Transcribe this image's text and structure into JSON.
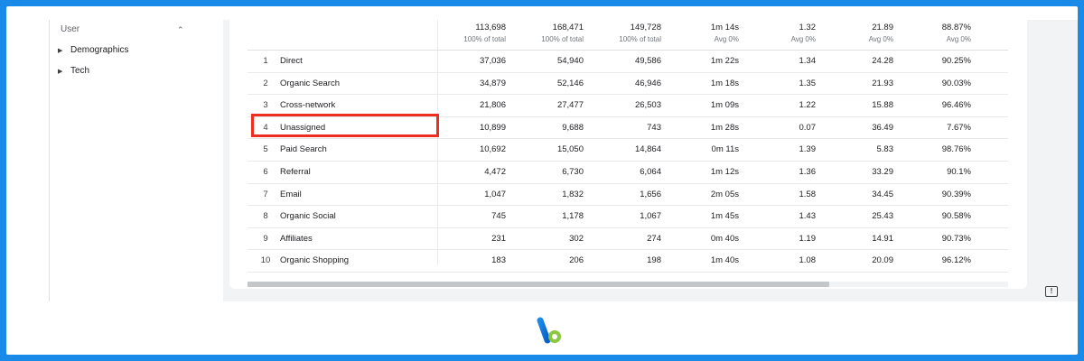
{
  "sidebar": {
    "section": "User",
    "items": [
      {
        "label": "Demographics"
      },
      {
        "label": "Tech"
      }
    ]
  },
  "table": {
    "totals": [
      {
        "value": "113,698",
        "sub": "100% of total"
      },
      {
        "value": "168,471",
        "sub": "100% of total"
      },
      {
        "value": "149,728",
        "sub": "100% of total"
      },
      {
        "value": "1m 14s",
        "sub": "Avg 0%"
      },
      {
        "value": "1.32",
        "sub": "Avg 0%"
      },
      {
        "value": "21.89",
        "sub": "Avg 0%"
      },
      {
        "value": "88.87%",
        "sub": "Avg 0%"
      }
    ],
    "rows": [
      {
        "idx": "1",
        "name": "Direct",
        "v": [
          "37,036",
          "54,940",
          "49,586",
          "1m 22s",
          "1.34",
          "24.28",
          "90.25%"
        ]
      },
      {
        "idx": "2",
        "name": "Organic Search",
        "v": [
          "34,879",
          "52,146",
          "46,946",
          "1m 18s",
          "1.35",
          "21.93",
          "90.03%"
        ]
      },
      {
        "idx": "3",
        "name": "Cross-network",
        "v": [
          "21,806",
          "27,477",
          "26,503",
          "1m 09s",
          "1.22",
          "15.88",
          "96.46%"
        ]
      },
      {
        "idx": "4",
        "name": "Unassigned",
        "v": [
          "10,899",
          "9,688",
          "743",
          "1m 28s",
          "0.07",
          "36.49",
          "7.67%"
        ]
      },
      {
        "idx": "5",
        "name": "Paid Search",
        "v": [
          "10,692",
          "15,050",
          "14,864",
          "0m 11s",
          "1.39",
          "5.83",
          "98.76%"
        ]
      },
      {
        "idx": "6",
        "name": "Referral",
        "v": [
          "4,472",
          "6,730",
          "6,064",
          "1m 12s",
          "1.36",
          "33.29",
          "90.1%"
        ]
      },
      {
        "idx": "7",
        "name": "Email",
        "v": [
          "1,047",
          "1,832",
          "1,656",
          "2m 05s",
          "1.58",
          "34.45",
          "90.39%"
        ]
      },
      {
        "idx": "8",
        "name": "Organic Social",
        "v": [
          "745",
          "1,178",
          "1,067",
          "1m 45s",
          "1.43",
          "25.43",
          "90.58%"
        ]
      },
      {
        "idx": "9",
        "name": "Affiliates",
        "v": [
          "231",
          "302",
          "274",
          "0m 40s",
          "1.19",
          "14.91",
          "90.73%"
        ]
      },
      {
        "idx": "10",
        "name": "Organic Shopping",
        "v": [
          "183",
          "206",
          "198",
          "1m 40s",
          "1.08",
          "20.09",
          "96.12%"
        ]
      }
    ]
  },
  "colors": {
    "border": "#1a8ae8",
    "highlight": "#ee2e1f"
  },
  "icons": {
    "chevron": "chevron-up-icon",
    "expand": "caret-right-icon",
    "feedback": "feedback-icon",
    "logo": "brand-logo-icon"
  }
}
